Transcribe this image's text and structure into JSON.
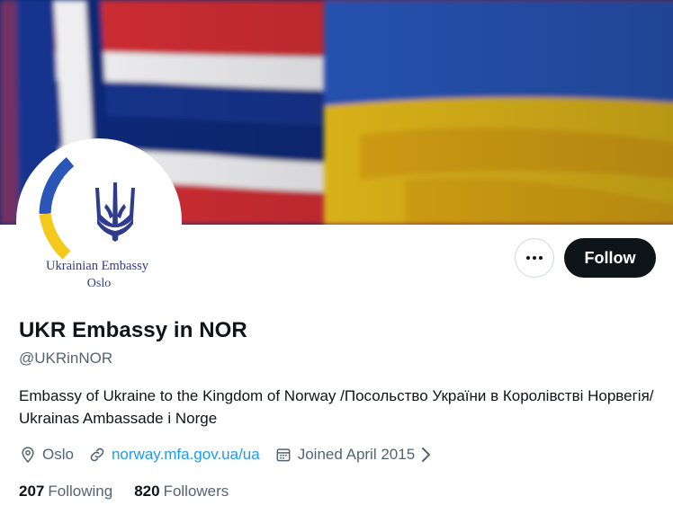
{
  "banner": {
    "flags": [
      "norway-flag",
      "ukraine-flag"
    ]
  },
  "avatar": {
    "line1": "Ukrainian Embassy",
    "line2": "Oslo"
  },
  "actions": {
    "more_icon": "more-horizontal-icon",
    "follow_label": "Follow"
  },
  "profile": {
    "display_name": "UKR Embassy in NOR",
    "handle": "@UKRinNOR",
    "bio": "Embassy of Ukraine to the Kingdom of Norway /Посольство України в Королівстві Норвегія/ Ukrainas Ambassade i Norge",
    "location": "Oslo",
    "website": "norway.mfa.gov.ua/ua",
    "joined": "Joined April 2015"
  },
  "stats": {
    "following_count": "207",
    "following_label": "Following",
    "followers_count": "820",
    "followers_label": "Followers"
  },
  "colors": {
    "accent": "#1d9bf0",
    "text_primary": "#0f1419",
    "text_secondary": "#536471",
    "ukraine_blue": "#2a56b8",
    "ukraine_yellow": "#f5c91c",
    "norway_red": "#d32f36",
    "norway_blue": "#0b2a7a"
  }
}
